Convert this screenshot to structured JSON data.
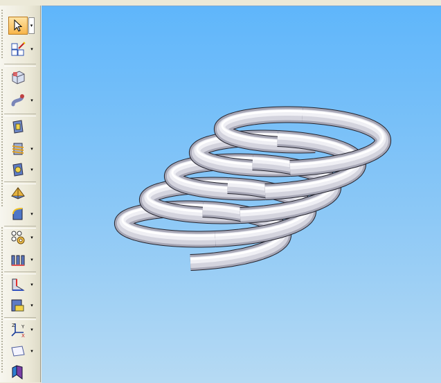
{
  "colors": {
    "viewport_top": "#5fb6fb",
    "viewport_bottom": "#b6daf3",
    "toolbar_bg": "#ece9d8",
    "active_tool": "#f8b64c",
    "spring": "#e4e4ea"
  },
  "toolbar": {
    "tools": [
      {
        "name": "select-arrow-icon",
        "dropdown": true,
        "active": true
      },
      {
        "name": "sketch-icon",
        "dropdown": true
      },
      {
        "name": "extrude-icon",
        "dropdown": false
      },
      {
        "name": "sweep-icon",
        "dropdown": true
      },
      {
        "name": "hole-icon",
        "dropdown": false
      },
      {
        "name": "thread-icon",
        "dropdown": true
      },
      {
        "name": "cutout-icon",
        "dropdown": true
      },
      {
        "name": "shell-icon",
        "dropdown": false
      },
      {
        "name": "round-icon",
        "dropdown": true
      },
      {
        "name": "pattern-icon",
        "dropdown": true
      },
      {
        "name": "rib-icon",
        "dropdown": true
      },
      {
        "name": "draft-icon",
        "dropdown": true
      },
      {
        "name": "base-plane-icon",
        "dropdown": true
      },
      {
        "name": "coordinate-system-icon",
        "dropdown": true
      },
      {
        "name": "plane-icon",
        "dropdown": true
      },
      {
        "name": "part-icon",
        "dropdown": false
      }
    ]
  },
  "model": {
    "name": "helical-spring",
    "turns": 5
  }
}
